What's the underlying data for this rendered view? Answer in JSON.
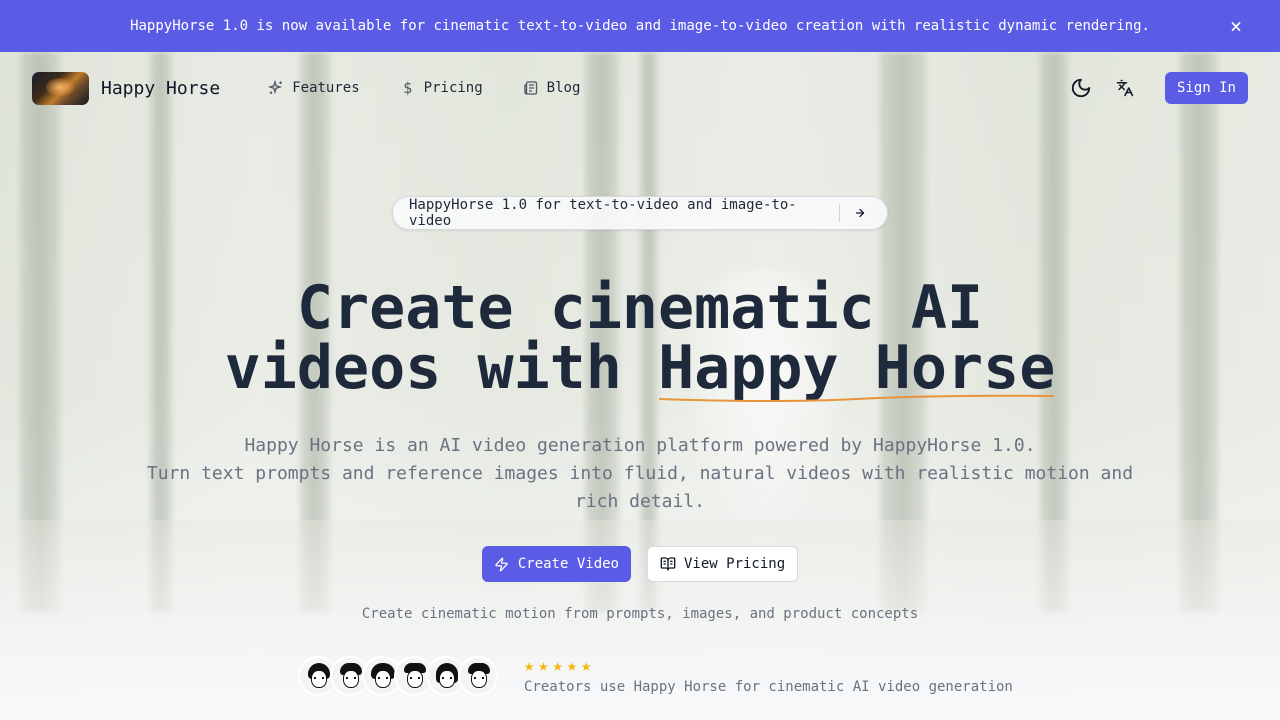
{
  "banner": {
    "text": "HappyHorse 1.0 is now available for cinematic text-to-video and image-to-video creation with realistic dynamic rendering.",
    "close_icon": "close-icon"
  },
  "nav": {
    "brand": "Happy Horse",
    "links": [
      {
        "label": "Features",
        "icon": "sparkles-icon"
      },
      {
        "label": "Pricing",
        "icon": "dollar-icon"
      },
      {
        "label": "Blog",
        "icon": "newspaper-icon"
      }
    ],
    "theme_icon": "moon-icon",
    "language_icon": "translate-icon",
    "sign_in": "Sign In"
  },
  "announcement": {
    "text": "HappyHorse 1.0 for text-to-video and image-to-video",
    "arrow_icon": "arrow-right-icon"
  },
  "hero": {
    "title_line1": "Create cinematic AI",
    "title_line2_prefix": "videos with ",
    "title_highlight": "Happy Horse",
    "subtitle_line1": "Happy Horse is an AI video generation platform powered by HappyHorse 1.0.",
    "subtitle_line2": "Turn text prompts and reference images into fluid, natural videos with realistic motion and rich detail."
  },
  "cta": {
    "primary": "Create Video",
    "secondary": "View Pricing"
  },
  "tagline": "Create cinematic motion from prompts, images, and product concepts",
  "social_proof": {
    "rating": 5,
    "caption": "Creators use Happy Horse for cinematic AI video generation",
    "avatar_count": 6
  },
  "colors": {
    "accent": "#5b5ce6",
    "star": "#f5b50a",
    "underline": "#e8943a"
  }
}
